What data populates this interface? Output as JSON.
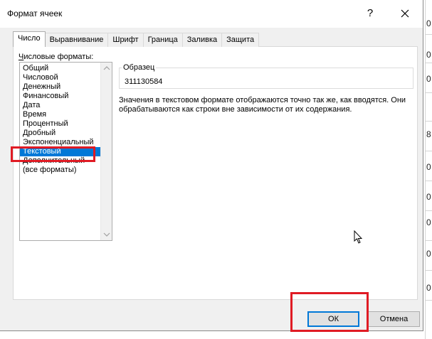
{
  "window": {
    "title": "Формат ячеек",
    "help_glyph": "?",
    "close_icon": "close-icon"
  },
  "tabs": [
    {
      "label": "Число",
      "active": true
    },
    {
      "label": "Выравнивание",
      "active": false
    },
    {
      "label": "Шрифт",
      "active": false
    },
    {
      "label": "Граница",
      "active": false
    },
    {
      "label": "Заливка",
      "active": false
    },
    {
      "label": "Защита",
      "active": false
    }
  ],
  "formats": {
    "label_first": "Ч",
    "label_rest": "исловые форматы:",
    "items": [
      "Общий",
      "Числовой",
      "Денежный",
      "Финансовый",
      "Дата",
      "Время",
      "Процентный",
      "Дробный",
      "Экспоненциальный",
      "Текстовый",
      "Дополнительный",
      "(все форматы)"
    ],
    "selected": "Текстовый"
  },
  "sample": {
    "legend": "Образец",
    "value": "311130584"
  },
  "description": "Значения в текстовом формате отображаются точно так же, как вводятся. Они обрабатываются как строки вне зависимости от их содержания.",
  "buttons": {
    "ok": "ОК",
    "cancel": "Отмена"
  },
  "background_digits": [
    "0",
    "0",
    "0",
    "8",
    "0",
    "0",
    "0",
    "0",
    "0"
  ],
  "colors": {
    "selection": "#0078d7",
    "highlight": "#e01b24",
    "dialog_bg": "#f0f0f0"
  }
}
